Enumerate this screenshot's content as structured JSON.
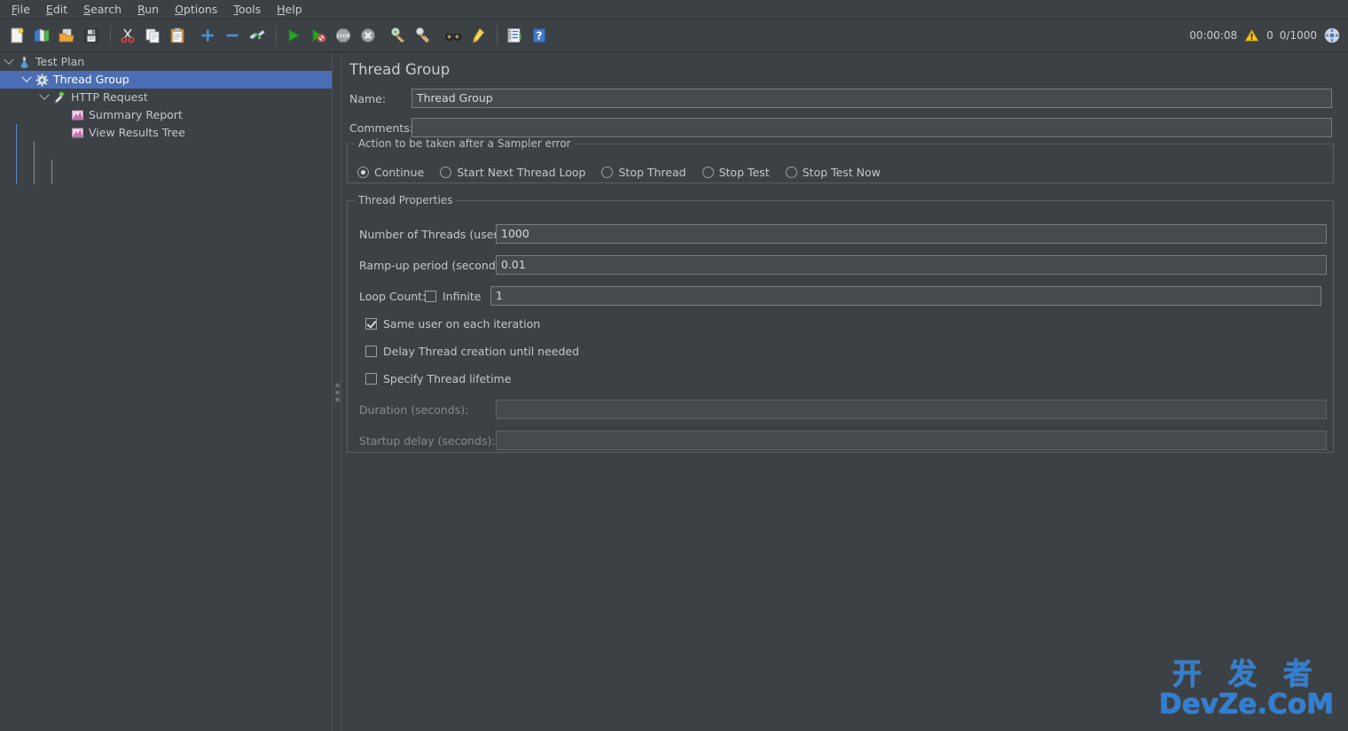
{
  "menubar": {
    "items": [
      {
        "label": "File",
        "mnemonic": "F"
      },
      {
        "label": "Edit",
        "mnemonic": "E"
      },
      {
        "label": "Search",
        "mnemonic": "S"
      },
      {
        "label": "Run",
        "mnemonic": "R"
      },
      {
        "label": "Options",
        "mnemonic": "O"
      },
      {
        "label": "Tools",
        "mnemonic": "T"
      },
      {
        "label": "Help",
        "mnemonic": "H"
      }
    ]
  },
  "toolbar": {
    "buttons": [
      {
        "name": "new-icon",
        "title": "New"
      },
      {
        "name": "templates-icon",
        "title": "Templates"
      },
      {
        "name": "open-icon",
        "title": "Open"
      },
      {
        "name": "save-icon",
        "title": "Save Test Plan"
      },
      {
        "name": "cut-icon",
        "title": "Cut"
      },
      {
        "name": "copy-icon",
        "title": "Copy"
      },
      {
        "name": "paste-icon",
        "title": "Paste"
      },
      {
        "name": "expand-all-icon",
        "title": "Expand All"
      },
      {
        "name": "collapse-all-icon",
        "title": "Collapse All"
      },
      {
        "name": "toggle-icon",
        "title": "Toggle"
      },
      {
        "name": "start-icon",
        "title": "Start"
      },
      {
        "name": "start-no-pauses-icon",
        "title": "Start no pauses"
      },
      {
        "name": "stop-icon",
        "title": "Stop"
      },
      {
        "name": "shutdown-icon",
        "title": "Shutdown"
      },
      {
        "name": "clear-icon",
        "title": "Clear"
      },
      {
        "name": "clear-all-icon",
        "title": "Clear All"
      },
      {
        "name": "search-icon",
        "title": "Search"
      },
      {
        "name": "reset-search-icon",
        "title": "Reset Search"
      },
      {
        "name": "function-helper-icon",
        "title": "Function Helper Dialog"
      },
      {
        "name": "help-icon",
        "title": "Help"
      }
    ]
  },
  "status": {
    "elapsed_time": "00:00:08",
    "warning_count": "0",
    "threads_running": "0/1000",
    "warning_icon": "warning-triangle-icon",
    "remote_icon": "connection-icon"
  },
  "tree": {
    "nodes": [
      {
        "label": "Test Plan",
        "icon": "test-plan-icon",
        "depth": 0,
        "expanded": true,
        "selected": false
      },
      {
        "label": "Thread Group",
        "icon": "thread-group-icon",
        "depth": 1,
        "expanded": true,
        "selected": true
      },
      {
        "label": "HTTP Request",
        "icon": "http-request-icon",
        "depth": 2,
        "expanded": true,
        "selected": false
      },
      {
        "label": "Summary Report",
        "icon": "listener-icon",
        "depth": 3,
        "expanded": false,
        "selected": false
      },
      {
        "label": "View Results Tree",
        "icon": "listener-icon",
        "depth": 3,
        "expanded": false,
        "selected": false
      }
    ]
  },
  "panel": {
    "title": "Thread Group",
    "name_label": "Name:",
    "name_value": "Thread Group",
    "comments_label": "Comments:",
    "comments_value": "",
    "sampler_error": {
      "group_title": "Action to be taken after a Sampler error",
      "options": [
        {
          "label": "Continue",
          "selected": true
        },
        {
          "label": "Start Next Thread Loop",
          "selected": false
        },
        {
          "label": "Stop Thread",
          "selected": false
        },
        {
          "label": "Stop Test",
          "selected": false
        },
        {
          "label": "Stop Test Now",
          "selected": false
        }
      ]
    },
    "thread_properties": {
      "group_title": "Thread Properties",
      "num_threads_label": "Number of Threads (users):",
      "num_threads_value": "1000",
      "ramp_up_label": "Ramp-up period (seconds):",
      "ramp_up_value": "0.01",
      "loop_count_label": "Loop Count:",
      "loop_infinite_label": "Infinite",
      "loop_infinite_checked": false,
      "loop_count_value": "1",
      "checkboxes": [
        {
          "label": "Same user on each iteration",
          "checked": true
        },
        {
          "label": "Delay Thread creation until needed",
          "checked": false
        },
        {
          "label": "Specify Thread lifetime",
          "checked": false
        }
      ],
      "duration_label": "Duration (seconds):",
      "duration_value": "",
      "duration_enabled": false,
      "startup_delay_label": "Startup delay (seconds):",
      "startup_delay_value": "",
      "startup_delay_enabled": false
    }
  },
  "watermark": {
    "cn": "开 发 者",
    "en": "DevZe.CoM"
  },
  "colors": {
    "background": "#3c4146",
    "selection": "#4a6db5",
    "field_bg": "#454a4f",
    "text": "#c3c7cb",
    "watermark": "#2f7fd6"
  }
}
